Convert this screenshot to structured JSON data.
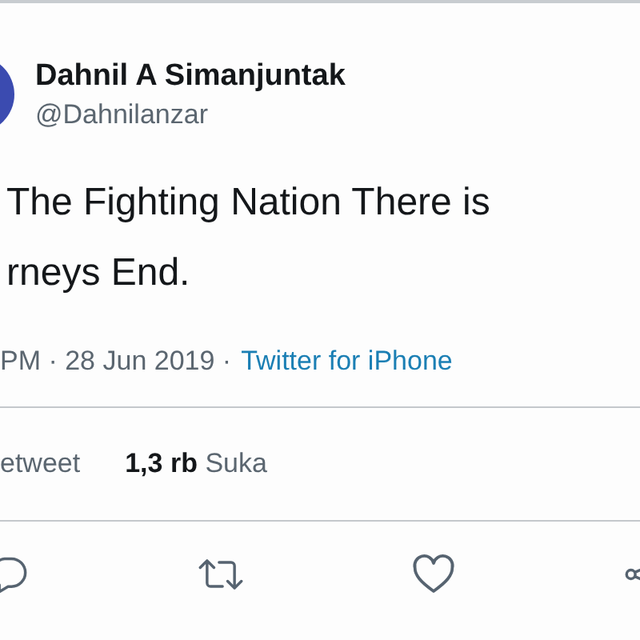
{
  "author": {
    "name": "Dahnil A Simanjuntak",
    "handle": "@Dahnilanzar"
  },
  "tweet_lines": [
    "The Fighting Nation There is",
    "rneys End."
  ],
  "meta": {
    "timestamp": "PM · 28 Jun 2019 ·",
    "source": "Twitter for iPhone"
  },
  "stats": [
    {
      "label": "etweet"
    },
    {
      "count": "1,3 rb",
      "label": "Suka"
    }
  ],
  "actions": [
    {
      "kind": "reply"
    },
    {
      "kind": "retweet"
    },
    {
      "kind": "like"
    },
    {
      "kind": "share"
    }
  ]
}
